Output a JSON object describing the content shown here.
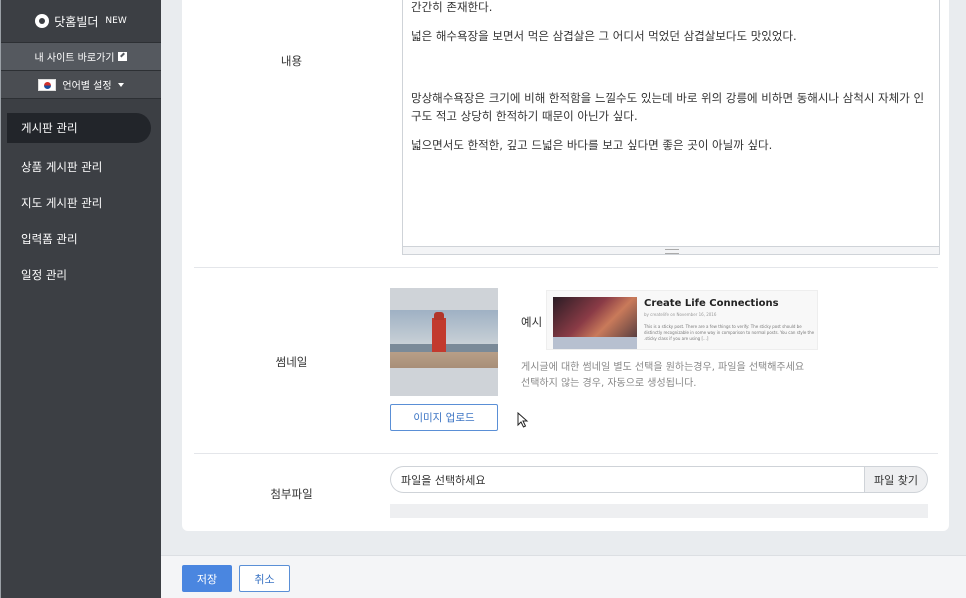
{
  "sidebar": {
    "brand": "닷홈빌더",
    "brand_badge": "NEW",
    "site_link": "내 사이트 바로가기",
    "language": "언어별 설정",
    "items": [
      {
        "label": "게시판 관리",
        "active": true
      },
      {
        "label": "상품 게시판 관리",
        "active": false
      },
      {
        "label": "지도 게시판 관리",
        "active": false
      },
      {
        "label": "입력폼 관리",
        "active": false
      },
      {
        "label": "일정 관리",
        "active": false
      }
    ]
  },
  "form": {
    "content": {
      "label": "내용",
      "paragraphs": [
        "간간히 존재한다.",
        "넓은 해수욕장을 보면서 먹은 삼겹살은 그 어디서 먹었던 삼겹살보다도 맛있었다.",
        "",
        "망상해수욕장은 크기에 비해 한적함을 느낄수도 있는데 바로 위의 강릉에 비하면 동해시나 삼척시 자체가 인구도 적고 상당히 한적하기 때문이 아닌가 싶다.",
        "넓으면서도 한적한, 깊고 드넓은 바다를 보고 싶다면 좋은 곳이 아닐까 싶다."
      ]
    },
    "thumbnail": {
      "label": "썸네일",
      "upload_button": "이미지 업로드",
      "example_label": "예시",
      "example_title": "Create Life Connections",
      "example_meta": "by createlife on November 16, 2016",
      "example_body": "This is a sticky post. There are a few things to verify: The sticky post should be distinctly recognizable in some way in comparison to normal posts. You can style the .sticky class if you are using [...]",
      "hint_line1": "게시글에 대한 썸네일 별도 선택을 원하는경우, 파일을 선택해주세요",
      "hint_line2": "선택하지 않는 경우, 자동으로 생성됩니다."
    },
    "attachment": {
      "label": "첨부파일",
      "placeholder": "파일을 선택하세요",
      "browse_button": "파일 찾기"
    }
  },
  "footer": {
    "save": "저장",
    "cancel": "취소"
  }
}
